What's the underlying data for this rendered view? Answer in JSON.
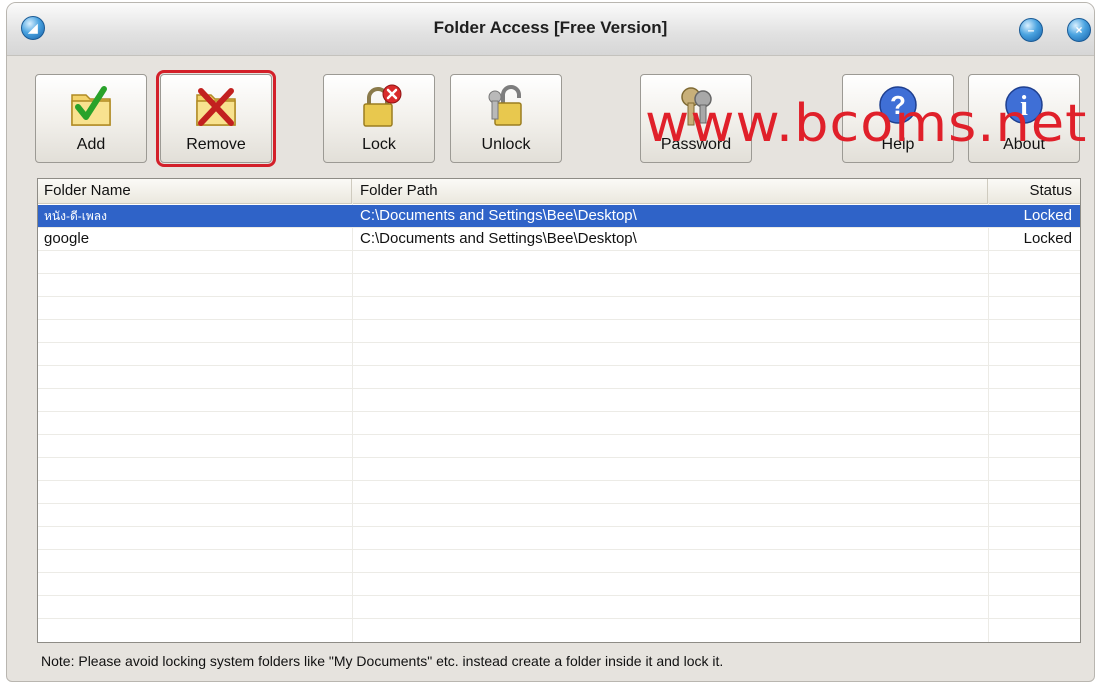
{
  "window": {
    "title": "Folder Access [Free Version]"
  },
  "toolbar": {
    "buttons": [
      {
        "id": "add",
        "label": "Add",
        "icon": "folder-check-icon"
      },
      {
        "id": "remove",
        "label": "Remove",
        "icon": "folder-remove-icon",
        "selected": true
      },
      {
        "id": "lock",
        "label": "Lock",
        "icon": "padlock-locked-icon"
      },
      {
        "id": "unlock",
        "label": "Unlock",
        "icon": "padlock-unlocked-icon"
      },
      {
        "id": "password",
        "label": "Password",
        "icon": "keys-icon"
      },
      {
        "id": "help",
        "label": "Help",
        "icon": "help-icon"
      },
      {
        "id": "about",
        "label": "About",
        "icon": "info-icon"
      }
    ]
  },
  "watermark": "www.bcoms.net",
  "list": {
    "columns": [
      "Folder Name",
      "Folder Path",
      "Status"
    ],
    "rows": [
      {
        "name": "หนัง-ดี-เพลง",
        "path": "C:\\Documents and Settings\\Bee\\Desktop\\",
        "status": "Locked",
        "selected": true
      },
      {
        "name": "google",
        "path": "C:\\Documents and Settings\\Bee\\Desktop\\",
        "status": "Locked",
        "selected": false
      }
    ]
  },
  "note": "Note: Please avoid locking system folders like \"My Documents\" etc. instead create a folder inside it and lock it.",
  "colors": {
    "selection": "#2f63c8",
    "highlight_border": "#d3202a",
    "watermark": "#e0202a"
  }
}
